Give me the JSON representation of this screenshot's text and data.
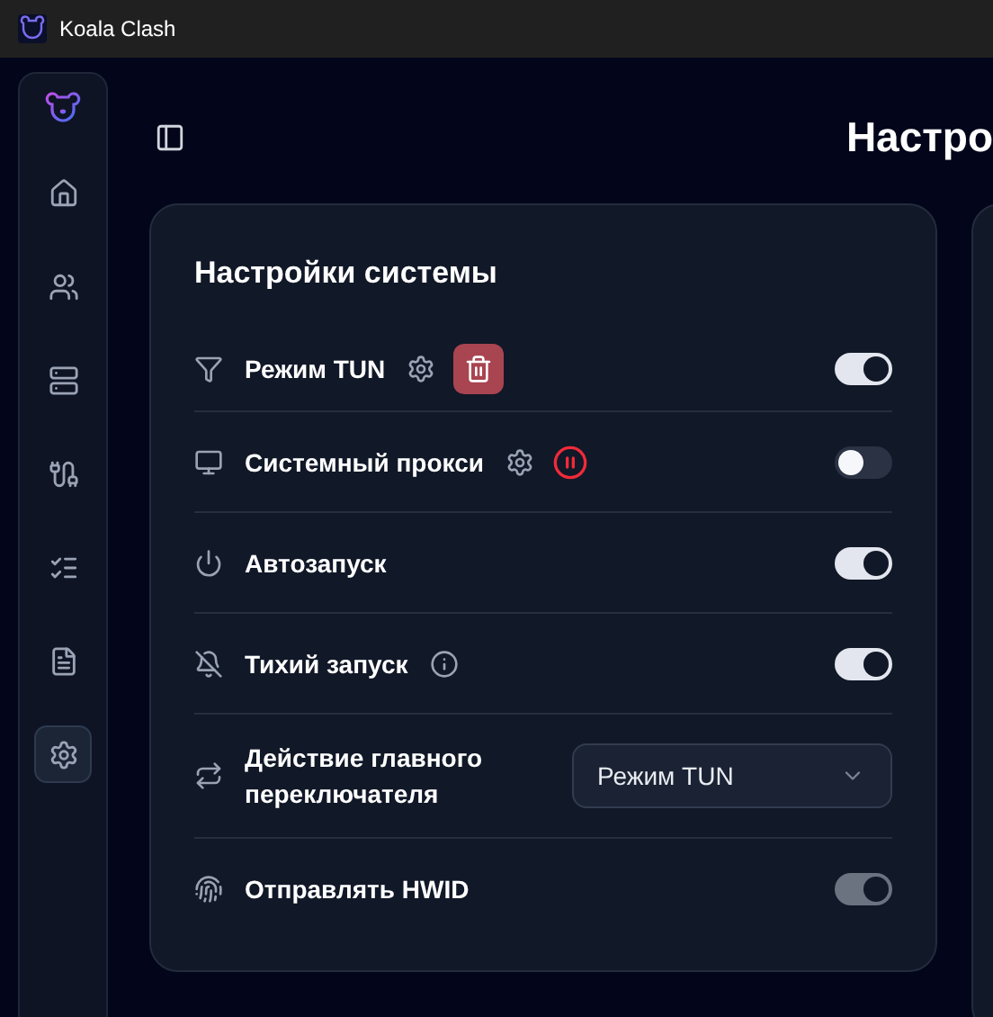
{
  "window": {
    "title": "Koala Clash"
  },
  "sidebar": {
    "items": [
      {
        "selected": false
      },
      {
        "selected": false
      },
      {
        "selected": false
      },
      {
        "selected": false
      },
      {
        "selected": false
      },
      {
        "selected": false
      },
      {
        "selected": true
      }
    ]
  },
  "page_title": "Настро",
  "card": {
    "title": "Настройки системы",
    "rows": [
      {
        "label": "Режим TUN",
        "actions": [
          {
            "kind": "settings"
          },
          {
            "kind": "delete"
          }
        ],
        "kind": "toggle",
        "on": true,
        "disabled": false
      },
      {
        "label": "Системный прокси",
        "actions": [
          {
            "kind": "settings"
          },
          {
            "kind": "paused"
          }
        ],
        "kind": "toggle",
        "on": false,
        "disabled": false
      },
      {
        "label": "Автозапуск",
        "actions": [],
        "kind": "toggle",
        "on": true,
        "disabled": false
      },
      {
        "label": "Тихий запуск",
        "actions": [
          {
            "kind": "info"
          }
        ],
        "kind": "toggle",
        "on": true,
        "disabled": false
      },
      {
        "label": "Действие главного переключателя",
        "actions": [],
        "kind": "select",
        "value": "Режим TUN"
      },
      {
        "label": "Отправлять HWID",
        "actions": [],
        "kind": "toggle",
        "on": true,
        "disabled": true
      }
    ]
  }
}
